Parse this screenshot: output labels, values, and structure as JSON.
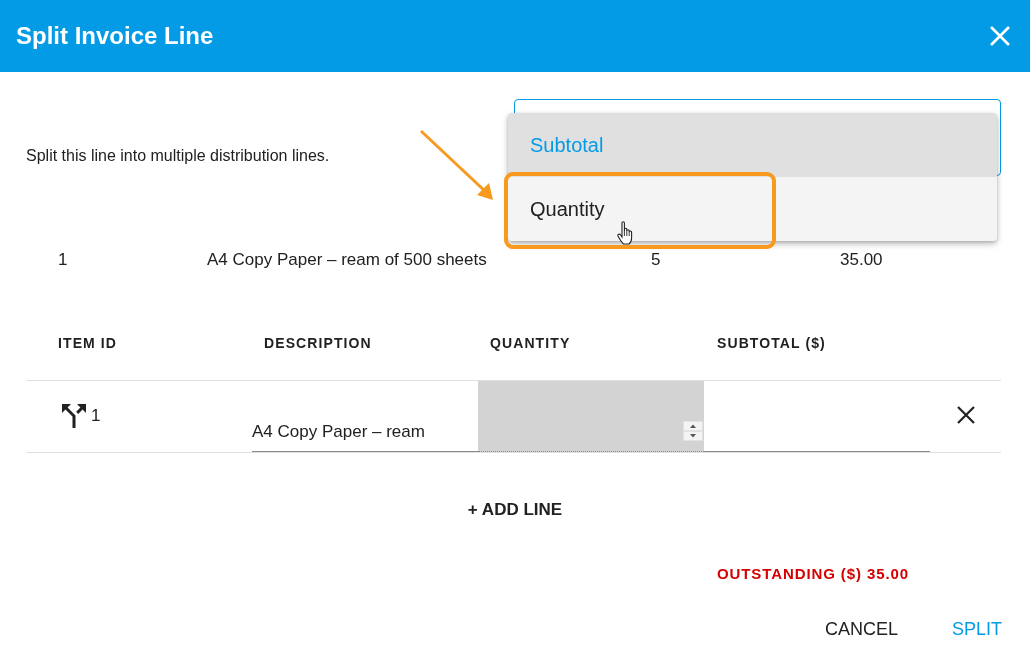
{
  "dialog": {
    "title": "Split Invoice Line"
  },
  "intro": "Split this line into multiple distribution lines.",
  "split_by": {
    "options": [
      {
        "label": "Subtotal",
        "selected": true,
        "hovered": false,
        "callout": false
      },
      {
        "label": "Quantity",
        "selected": false,
        "hovered": true,
        "callout": true
      }
    ]
  },
  "original_line": {
    "item_id": "1",
    "description": "A4 Copy Paper – ream of 500 sheets",
    "quantity": "5",
    "subtotal": "35.00"
  },
  "table": {
    "columns": [
      "ITEM ID",
      "DESCRIPTION",
      "QUANTITY",
      "SUBTOTAL ($)"
    ],
    "rows": [
      {
        "item_id": "1",
        "description": "A4 Copy Paper – ream",
        "quantity_disabled": true
      }
    ]
  },
  "add_line": "+ ADD LINE",
  "outstanding": "OUTSTANDING ($) 35.00",
  "buttons": [
    {
      "label": "CANCEL",
      "kind": "secondary"
    },
    {
      "label": "SPLIT",
      "kind": "primary"
    }
  ]
}
